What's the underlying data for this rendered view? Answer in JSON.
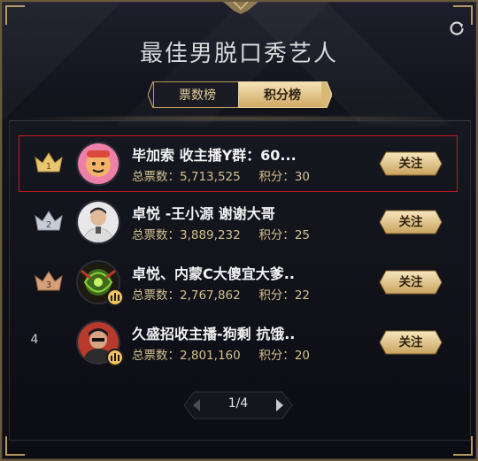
{
  "header": {
    "title": "最佳男脱口秀艺人"
  },
  "tabs": [
    {
      "label": "票数榜",
      "active": false
    },
    {
      "label": "积分榜",
      "active": true
    }
  ],
  "rows": [
    {
      "rank": "1",
      "name": "毕加索 收主播Y群：60...",
      "votes_label": "总票数：",
      "votes": "5,713,525",
      "points_label": "积分：",
      "points": "30",
      "follow": "关注",
      "highlighted": true
    },
    {
      "rank": "2",
      "name": "卓悦 -王小源 谢谢大哥",
      "votes_label": "总票数：",
      "votes": "3,889,232",
      "points_label": "积分：",
      "points": "25",
      "follow": "关注"
    },
    {
      "rank": "3",
      "name": "卓悦、内蒙C大傻宜大爹..",
      "votes_label": "总票数：",
      "votes": "2,767,862",
      "points_label": "积分：",
      "points": "22",
      "follow": "关注"
    },
    {
      "rank": "4",
      "name": "久盛招收主播-狗剩 抗饿..",
      "votes_label": "总票数：",
      "votes": "2,801,160",
      "points_label": "积分：",
      "points": "20",
      "follow": "关注"
    }
  ],
  "pager": {
    "text": "1/4"
  },
  "colors": {
    "gold": "#d3c08f",
    "accent_red": "#c8181f",
    "crown_gold": "#e8c672",
    "crown_silver": "#c7ccd6",
    "crown_bronze": "#d6a07a"
  }
}
